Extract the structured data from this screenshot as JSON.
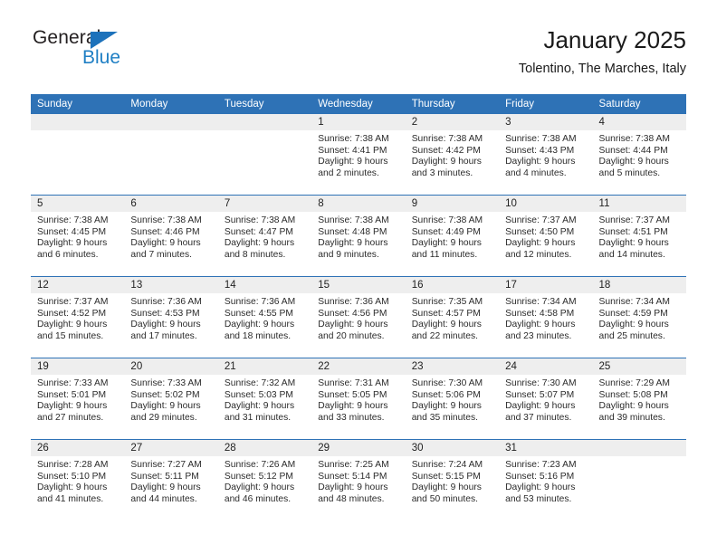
{
  "brand": {
    "name_top": "General",
    "name_bottom": "Blue",
    "accent_color": "#1d72bb"
  },
  "header": {
    "title": "January 2025",
    "subtitle": "Tolentino, The Marches, Italy"
  },
  "theme": {
    "header_blue": "#2e72b6",
    "daynum_band": "#eeeeee",
    "text": "#2b2b2b"
  },
  "weekdays": [
    "Sunday",
    "Monday",
    "Tuesday",
    "Wednesday",
    "Thursday",
    "Friday",
    "Saturday"
  ],
  "weeks": [
    [
      {
        "day": "",
        "empty": true
      },
      {
        "day": "",
        "empty": true
      },
      {
        "day": "",
        "empty": true
      },
      {
        "day": "1",
        "sunrise": "Sunrise: 7:38 AM",
        "sunset": "Sunset: 4:41 PM",
        "daylight1": "Daylight: 9 hours",
        "daylight2": "and 2 minutes."
      },
      {
        "day": "2",
        "sunrise": "Sunrise: 7:38 AM",
        "sunset": "Sunset: 4:42 PM",
        "daylight1": "Daylight: 9 hours",
        "daylight2": "and 3 minutes."
      },
      {
        "day": "3",
        "sunrise": "Sunrise: 7:38 AM",
        "sunset": "Sunset: 4:43 PM",
        "daylight1": "Daylight: 9 hours",
        "daylight2": "and 4 minutes."
      },
      {
        "day": "4",
        "sunrise": "Sunrise: 7:38 AM",
        "sunset": "Sunset: 4:44 PM",
        "daylight1": "Daylight: 9 hours",
        "daylight2": "and 5 minutes."
      }
    ],
    [
      {
        "day": "5",
        "sunrise": "Sunrise: 7:38 AM",
        "sunset": "Sunset: 4:45 PM",
        "daylight1": "Daylight: 9 hours",
        "daylight2": "and 6 minutes."
      },
      {
        "day": "6",
        "sunrise": "Sunrise: 7:38 AM",
        "sunset": "Sunset: 4:46 PM",
        "daylight1": "Daylight: 9 hours",
        "daylight2": "and 7 minutes."
      },
      {
        "day": "7",
        "sunrise": "Sunrise: 7:38 AM",
        "sunset": "Sunset: 4:47 PM",
        "daylight1": "Daylight: 9 hours",
        "daylight2": "and 8 minutes."
      },
      {
        "day": "8",
        "sunrise": "Sunrise: 7:38 AM",
        "sunset": "Sunset: 4:48 PM",
        "daylight1": "Daylight: 9 hours",
        "daylight2": "and 9 minutes."
      },
      {
        "day": "9",
        "sunrise": "Sunrise: 7:38 AM",
        "sunset": "Sunset: 4:49 PM",
        "daylight1": "Daylight: 9 hours",
        "daylight2": "and 11 minutes."
      },
      {
        "day": "10",
        "sunrise": "Sunrise: 7:37 AM",
        "sunset": "Sunset: 4:50 PM",
        "daylight1": "Daylight: 9 hours",
        "daylight2": "and 12 minutes."
      },
      {
        "day": "11",
        "sunrise": "Sunrise: 7:37 AM",
        "sunset": "Sunset: 4:51 PM",
        "daylight1": "Daylight: 9 hours",
        "daylight2": "and 14 minutes."
      }
    ],
    [
      {
        "day": "12",
        "sunrise": "Sunrise: 7:37 AM",
        "sunset": "Sunset: 4:52 PM",
        "daylight1": "Daylight: 9 hours",
        "daylight2": "and 15 minutes."
      },
      {
        "day": "13",
        "sunrise": "Sunrise: 7:36 AM",
        "sunset": "Sunset: 4:53 PM",
        "daylight1": "Daylight: 9 hours",
        "daylight2": "and 17 minutes."
      },
      {
        "day": "14",
        "sunrise": "Sunrise: 7:36 AM",
        "sunset": "Sunset: 4:55 PM",
        "daylight1": "Daylight: 9 hours",
        "daylight2": "and 18 minutes."
      },
      {
        "day": "15",
        "sunrise": "Sunrise: 7:36 AM",
        "sunset": "Sunset: 4:56 PM",
        "daylight1": "Daylight: 9 hours",
        "daylight2": "and 20 minutes."
      },
      {
        "day": "16",
        "sunrise": "Sunrise: 7:35 AM",
        "sunset": "Sunset: 4:57 PM",
        "daylight1": "Daylight: 9 hours",
        "daylight2": "and 22 minutes."
      },
      {
        "day": "17",
        "sunrise": "Sunrise: 7:34 AM",
        "sunset": "Sunset: 4:58 PM",
        "daylight1": "Daylight: 9 hours",
        "daylight2": "and 23 minutes."
      },
      {
        "day": "18",
        "sunrise": "Sunrise: 7:34 AM",
        "sunset": "Sunset: 4:59 PM",
        "daylight1": "Daylight: 9 hours",
        "daylight2": "and 25 minutes."
      }
    ],
    [
      {
        "day": "19",
        "sunrise": "Sunrise: 7:33 AM",
        "sunset": "Sunset: 5:01 PM",
        "daylight1": "Daylight: 9 hours",
        "daylight2": "and 27 minutes."
      },
      {
        "day": "20",
        "sunrise": "Sunrise: 7:33 AM",
        "sunset": "Sunset: 5:02 PM",
        "daylight1": "Daylight: 9 hours",
        "daylight2": "and 29 minutes."
      },
      {
        "day": "21",
        "sunrise": "Sunrise: 7:32 AM",
        "sunset": "Sunset: 5:03 PM",
        "daylight1": "Daylight: 9 hours",
        "daylight2": "and 31 minutes."
      },
      {
        "day": "22",
        "sunrise": "Sunrise: 7:31 AM",
        "sunset": "Sunset: 5:05 PM",
        "daylight1": "Daylight: 9 hours",
        "daylight2": "and 33 minutes."
      },
      {
        "day": "23",
        "sunrise": "Sunrise: 7:30 AM",
        "sunset": "Sunset: 5:06 PM",
        "daylight1": "Daylight: 9 hours",
        "daylight2": "and 35 minutes."
      },
      {
        "day": "24",
        "sunrise": "Sunrise: 7:30 AM",
        "sunset": "Sunset: 5:07 PM",
        "daylight1": "Daylight: 9 hours",
        "daylight2": "and 37 minutes."
      },
      {
        "day": "25",
        "sunrise": "Sunrise: 7:29 AM",
        "sunset": "Sunset: 5:08 PM",
        "daylight1": "Daylight: 9 hours",
        "daylight2": "and 39 minutes."
      }
    ],
    [
      {
        "day": "26",
        "sunrise": "Sunrise: 7:28 AM",
        "sunset": "Sunset: 5:10 PM",
        "daylight1": "Daylight: 9 hours",
        "daylight2": "and 41 minutes."
      },
      {
        "day": "27",
        "sunrise": "Sunrise: 7:27 AM",
        "sunset": "Sunset: 5:11 PM",
        "daylight1": "Daylight: 9 hours",
        "daylight2": "and 44 minutes."
      },
      {
        "day": "28",
        "sunrise": "Sunrise: 7:26 AM",
        "sunset": "Sunset: 5:12 PM",
        "daylight1": "Daylight: 9 hours",
        "daylight2": "and 46 minutes."
      },
      {
        "day": "29",
        "sunrise": "Sunrise: 7:25 AM",
        "sunset": "Sunset: 5:14 PM",
        "daylight1": "Daylight: 9 hours",
        "daylight2": "and 48 minutes."
      },
      {
        "day": "30",
        "sunrise": "Sunrise: 7:24 AM",
        "sunset": "Sunset: 5:15 PM",
        "daylight1": "Daylight: 9 hours",
        "daylight2": "and 50 minutes."
      },
      {
        "day": "31",
        "sunrise": "Sunrise: 7:23 AM",
        "sunset": "Sunset: 5:16 PM",
        "daylight1": "Daylight: 9 hours",
        "daylight2": "and 53 minutes."
      },
      {
        "day": "",
        "empty": true
      }
    ]
  ]
}
